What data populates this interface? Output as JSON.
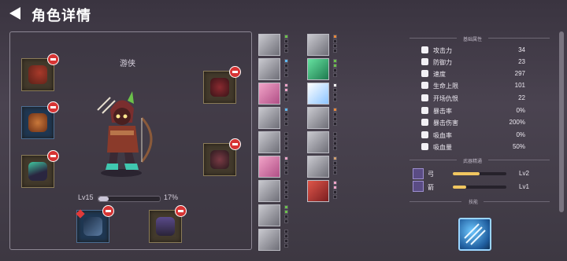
{
  "header": {
    "title": "角色详情"
  },
  "hero": {
    "class_name": "游侠",
    "level": "Lv15",
    "xp_percent_text": "17%",
    "xp_fraction": 0.17
  },
  "stats_section": {
    "title": "基础属性"
  },
  "stats": [
    {
      "icon": "sword-icon",
      "label": "攻击力",
      "value": "34"
    },
    {
      "icon": "shield-icon",
      "label": "防御力",
      "value": "23"
    },
    {
      "icon": "boot-icon",
      "label": "速度",
      "value": "297"
    },
    {
      "icon": "heart-icon",
      "label": "生命上限",
      "value": "101"
    },
    {
      "icon": "skull-icon",
      "label": "开场仇恨",
      "value": "22"
    },
    {
      "icon": "crossed-swords-icon",
      "label": "暴击率",
      "value": "0%"
    },
    {
      "icon": "crossed-swords-icon",
      "label": "暴击伤害",
      "value": "200%"
    },
    {
      "icon": "drop-icon",
      "label": "吸血率",
      "value": "0%"
    },
    {
      "icon": "fangs-icon",
      "label": "吸血量",
      "value": "50%"
    }
  ],
  "weapons_section": {
    "title": "武器精通"
  },
  "weapons": [
    {
      "icon": "bow-icon",
      "label": "弓",
      "level": "Lv2",
      "progress": 0.5
    },
    {
      "icon": "arrow-icon",
      "label": "箭",
      "level": "Lv1",
      "progress": 0.25
    }
  ],
  "skills_section": {
    "title": "技能"
  },
  "colors": {
    "remove": "#d63434",
    "xp_fill": "#c9c4d6",
    "weapon_fill": "#f0c660",
    "stat_text": "#ece8f0"
  }
}
